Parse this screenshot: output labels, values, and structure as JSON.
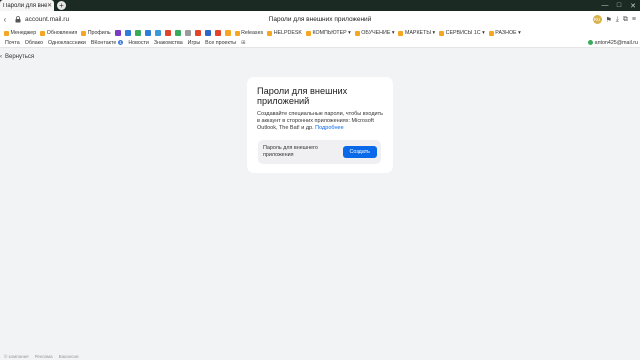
{
  "browser": {
    "tab_title": "Пароли для внешних",
    "new_tab": "+",
    "url": "account.mail.ru",
    "page_title": "Пароли для внешних приложений",
    "profile_badge": "RU"
  },
  "bookmarks": [
    {
      "label": "Менеджер",
      "color": "#f5a623"
    },
    {
      "label": "Обновления",
      "color": "#f5a623"
    },
    {
      "label": "Профиль",
      "color": "#f5a623"
    }
  ],
  "bookmark_icons": [
    "#7a3cc2",
    "#2e7dd8",
    "#3aaa5c",
    "#2e7dd8",
    "#3a9ad9",
    "#e0452b",
    "#3aaa5c",
    "#9a9a9a",
    "#e0452b",
    "#2b66c9",
    "#e0452b",
    "#f5a623"
  ],
  "bookmark_more": [
    {
      "label": "Releases",
      "color": "#f5a623"
    },
    {
      "label": "HELPDESK",
      "color": "#f5a623"
    },
    {
      "label": "КОМПЬЮТЕР ▾",
      "color": "#f5a623"
    },
    {
      "label": "ОБУЧЕНИЕ ▾",
      "color": "#f5a623"
    },
    {
      "label": "МАРКЕТЫ ▾",
      "color": "#f5a623"
    },
    {
      "label": "СЕРВИСЫ 1С ▾",
      "color": "#f5a623"
    },
    {
      "label": "РАЗНОЕ ▾",
      "color": "#f5a623"
    }
  ],
  "mail_nav": {
    "items": [
      "Почта",
      "Облако",
      "Одноклассники",
      "ВКонтакте",
      "Новости",
      "Знакомства",
      "Игры",
      "Все проекты"
    ],
    "vk_badge": "1",
    "account": "anton425@mail.ru"
  },
  "back_label": "Вернуться",
  "card": {
    "title": "Пароли для внешних приложений",
    "description": "Создавайте специальные пароли, чтобы входить в аккаунт в сторонних приложениях: Microsoft Outlook, The Bat! и др.",
    "link": "Подробнее",
    "field_label": "Пароль для внешнего приложения",
    "button": "Создать"
  },
  "footer": [
    "© компания",
    "Реклама",
    "Вакансии"
  ]
}
